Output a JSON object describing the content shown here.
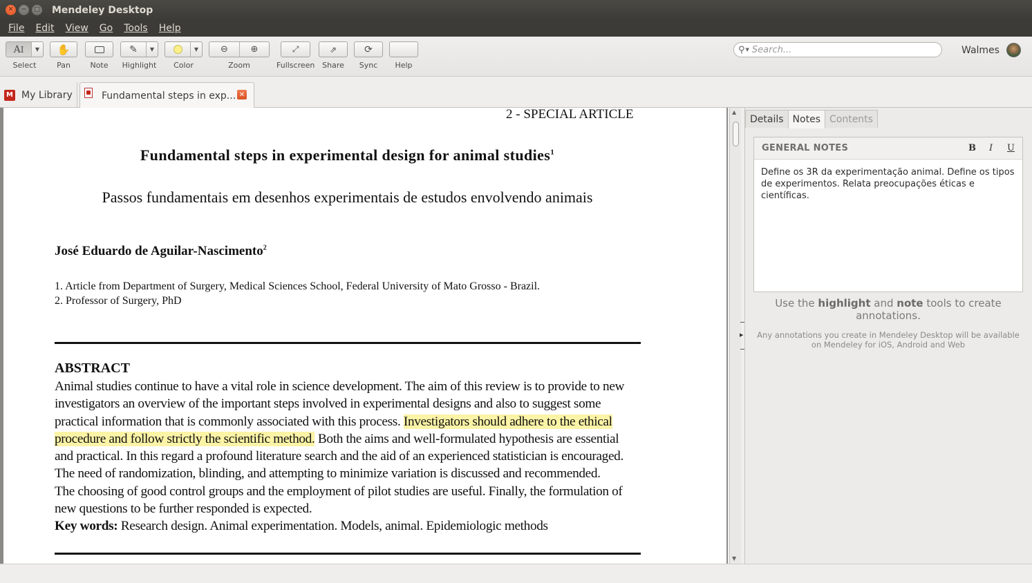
{
  "window": {
    "title": "Mendeley Desktop"
  },
  "menu": [
    "File",
    "Edit",
    "View",
    "Go",
    "Tools",
    "Help"
  ],
  "toolbar": {
    "select": "Select",
    "pan": "Pan",
    "note": "Note",
    "highlight": "Highlight",
    "color": "Color",
    "zoom": "Zoom",
    "fullscreen": "Fullscreen",
    "share": "Share",
    "sync": "Sync",
    "help": "Help"
  },
  "search": {
    "placeholder": "Search..."
  },
  "user": {
    "name": "Walmes"
  },
  "tabs": {
    "library": "My Library",
    "document": "Fundamental steps in exp..."
  },
  "pdf": {
    "header": "2 - SPECIAL ARTICLE",
    "title": "Fundamental steps in experimental design for animal studies",
    "title_sup": "1",
    "subtitle": "Passos fundamentais em desenhos experimentais de estudos envolvendo animais",
    "author": "José Eduardo de Aguilar-Nascimento",
    "author_sup": "2",
    "aff1": "1. Article from Department of Surgery, Medical Sciences School, Federal University of Mato Grosso - Brazil.",
    "aff2": "2. Professor of Surgery, PhD",
    "abstract_title": "ABSTRACT",
    "abstract": {
      "l1": "Animal studies continue to have a vital role in science development. The aim of this review is to provide to new",
      "l2": "investigators an overview of the important steps involved in experimental designs and also to suggest some",
      "l3a": "practical information that is commonly associated with this process. ",
      "l3b": "Investigators should adhere to the ethical",
      "l4a": "procedure and follow strictly the scientific method.",
      "l4b": " Both the aims and well-formulated hypothesis are essential",
      "l5": "and practical. In this regard a profound literature search and the aid of an experienced statistician is encouraged.",
      "l6": "The need of randomization, blinding, and attempting to minimize variation is discussed and recommended.",
      "l7": "The choosing of good control groups and the employment of pilot studies are useful. Finally, the formulation of",
      "l8": "new questions to be further responded is expected.",
      "kw_label": "Key words:",
      "kw": " Research design. Animal experimentation. Models, animal. Epidemiologic methods"
    }
  },
  "panel": {
    "tabs": {
      "details": "Details",
      "notes": "Notes",
      "contents": "Contents"
    },
    "general_notes_label": "GENERAL NOTES",
    "bold": "B",
    "italic": "I",
    "underline": "U",
    "notes_text": "Define os 3R da experimentação animal. Define os tipos de experimentos. Relata preocupações éticas e científicas.",
    "hint": {
      "use": "Use the ",
      "highlight": "highlight",
      "and": " and ",
      "note": "note",
      "rest": " tools to create annotations."
    },
    "hint_small": "Any annotations you create in Mendeley Desktop will be available on Mendeley for iOS, Android and Web"
  },
  "colors": {
    "highlight": "#fbf3a6",
    "brand": "#c4261c",
    "close_button": "#e0501a"
  }
}
